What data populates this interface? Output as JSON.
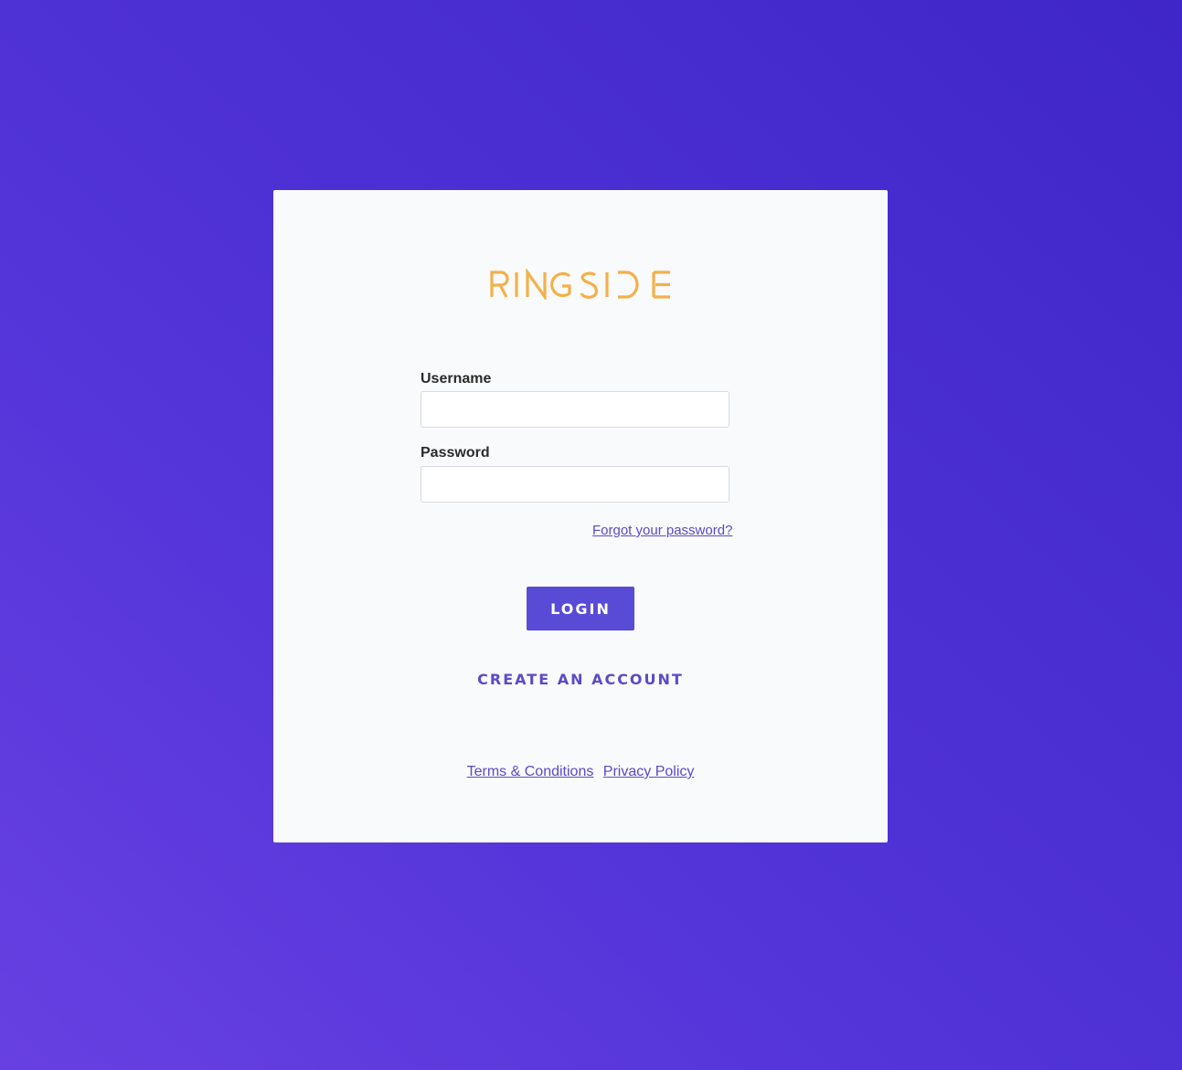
{
  "brand": {
    "name": "RINGSIDE",
    "color": "#f4b04a"
  },
  "form": {
    "username_label": "Username",
    "username_value": "",
    "password_label": "Password",
    "password_value": "",
    "forgot_link": "Forgot your password?",
    "login_button": "LOGIN",
    "create_account": "CREATE AN ACCOUNT"
  },
  "footer": {
    "terms": "Terms & Conditions",
    "privacy": "Privacy Policy"
  },
  "colors": {
    "background_start": "#6840e2",
    "background_end": "#3f26c8",
    "accent": "#5a4bd6",
    "link": "#5a4bc7"
  }
}
